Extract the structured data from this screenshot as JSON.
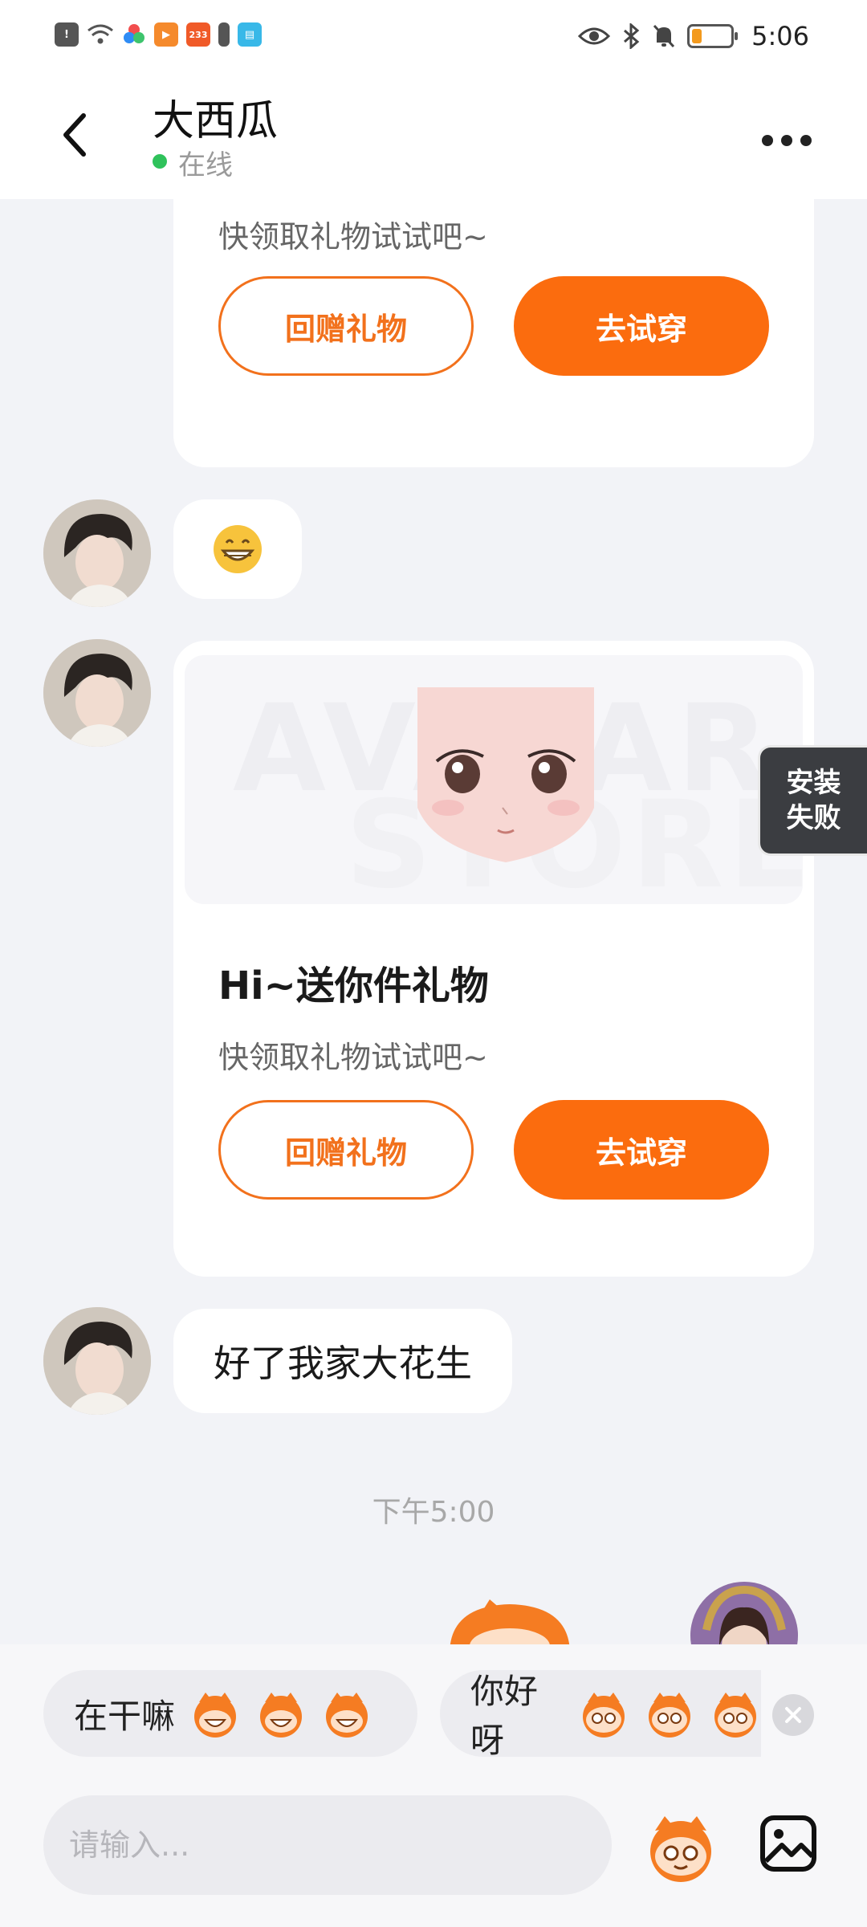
{
  "status_bar": {
    "time": "5:06",
    "app_badge": "233"
  },
  "header": {
    "title": "大西瓜",
    "status": "在线"
  },
  "messages": {
    "card1": {
      "subtitle": "快领取礼物试试吧~",
      "btn_return": "回赠礼物",
      "btn_try": "去试穿"
    },
    "emoji_msg": {
      "text": "😁"
    },
    "card2": {
      "watermark_1": "AVATAR",
      "watermark_2": "STORE",
      "title": "Hi~送你件礼物",
      "subtitle": "快领取礼物试试吧~",
      "btn_return": "回赠礼物",
      "btn_try": "去试穿"
    },
    "text_msg": {
      "text": "好了我家大花生"
    },
    "time_divider": "下午5:00"
  },
  "side_float": {
    "line1": "安装",
    "line2": "失败"
  },
  "quick_replies": [
    {
      "label": "在干嘛"
    },
    {
      "label": "你好呀"
    }
  ],
  "input": {
    "placeholder": "请输入..."
  },
  "colors": {
    "accent": "#fb6c0e",
    "online": "#2fc25b",
    "background": "#f2f3f7"
  },
  "icons": [
    "back-arrow-icon",
    "more-dots-icon",
    "emoji-mascot-icon",
    "image-icon",
    "close-icon"
  ]
}
